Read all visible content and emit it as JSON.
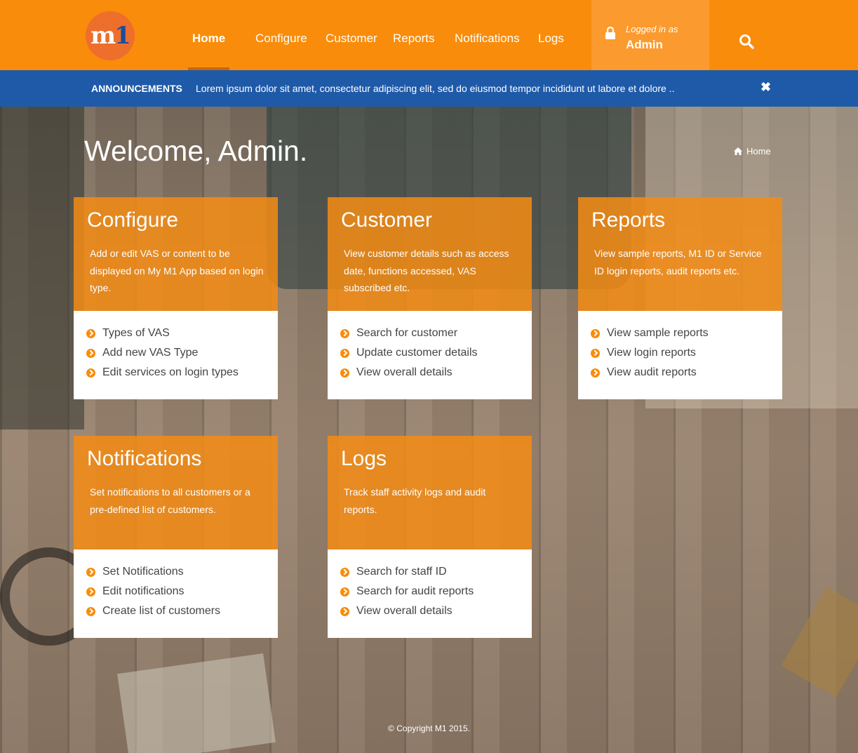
{
  "colors": {
    "brand_orange": "#f98c0a",
    "announce_blue": "#1f5aa9",
    "login_box": "#fb9a2e"
  },
  "logo": {
    "text": "m1"
  },
  "nav": {
    "items": [
      {
        "label": "Home",
        "active": true
      },
      {
        "label": "Configure"
      },
      {
        "label": "Customer"
      },
      {
        "label": "Reports"
      },
      {
        "label": "Notifications"
      },
      {
        "label": "Logs"
      }
    ]
  },
  "login": {
    "label": "Logged in as",
    "user": "Admin",
    "icon": "lock-icon"
  },
  "search": {
    "icon": "search-icon"
  },
  "announcement": {
    "title": "ANNOUNCEMENTS",
    "text": "Lorem ipsum dolor sit amet, consectetur adipiscing elit, sed do eiusmod tempor incididunt ut labore et dolore ..",
    "close": "✖"
  },
  "welcome": "Welcome, Admin.",
  "breadcrumb": {
    "label": "Home",
    "icon": "home-icon"
  },
  "cards": [
    {
      "title": "Configure",
      "desc": "Add or edit VAS or content to be displayed on My M1 App based on login type.",
      "links": [
        "Types of VAS",
        "Add new VAS Type",
        "Edit services on login types"
      ]
    },
    {
      "title": "Customer",
      "desc": "View customer details such as access date, functions accessed, VAS subscribed etc.",
      "links": [
        "Search for customer",
        "Update customer details",
        "View overall details"
      ]
    },
    {
      "title": "Reports",
      "desc": "View sample reports, M1 ID or Service ID login reports, audit reports etc.",
      "links": [
        "View sample reports",
        "View login reports",
        "View audit reports"
      ]
    },
    {
      "title": "Notifications",
      "desc": "Set notifications to all customers or a pre-defined list of customers.",
      "links": [
        "Set Notifications",
        "Edit notifications",
        "Create list of customers"
      ]
    },
    {
      "title": "Logs",
      "desc": "Track staff activity logs and audit reports.",
      "links": [
        "Search for staff ID",
        "Search for audit reports",
        "View overall details"
      ]
    }
  ],
  "footer": "© Copyright M1 2015."
}
